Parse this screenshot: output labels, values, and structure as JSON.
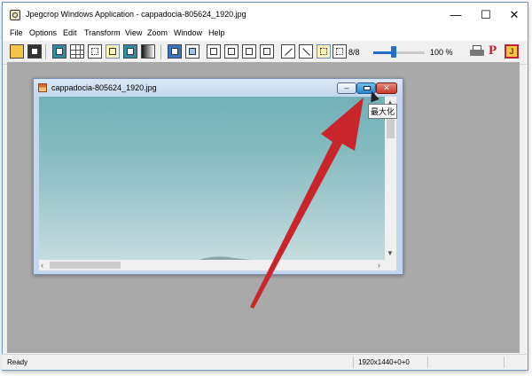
{
  "app": {
    "title": "Jpegcrop Windows Application - cappadocia-805624_1920.jpg",
    "minimize_glyph": "—",
    "maximize_glyph": "☐",
    "close_glyph": "✕"
  },
  "menu": [
    "File",
    "Options",
    "Edit",
    "Transform",
    "View",
    "Zoom",
    "Window",
    "Help"
  ],
  "toolbar": {
    "open_icon": "folder-open-icon",
    "save_icon": "save-icon",
    "position": "8/8",
    "zoom_label": "100 %",
    "zoom_slider_fraction": 0.4,
    "print_icon": "printer-icon",
    "p_label": "P",
    "j_label": "J"
  },
  "child": {
    "title": "cappadocia-805624_1920.jpg",
    "min_glyph": "–",
    "close_glyph": "✕"
  },
  "tooltip": {
    "text": "最大化"
  },
  "status": {
    "text": "Ready",
    "dimensions": "1920x1440+0+0"
  },
  "colors": {
    "annotation_arrow": "#c8262a",
    "mdi_background": "#a9a9a9",
    "child_title": "#c4d7ee"
  }
}
